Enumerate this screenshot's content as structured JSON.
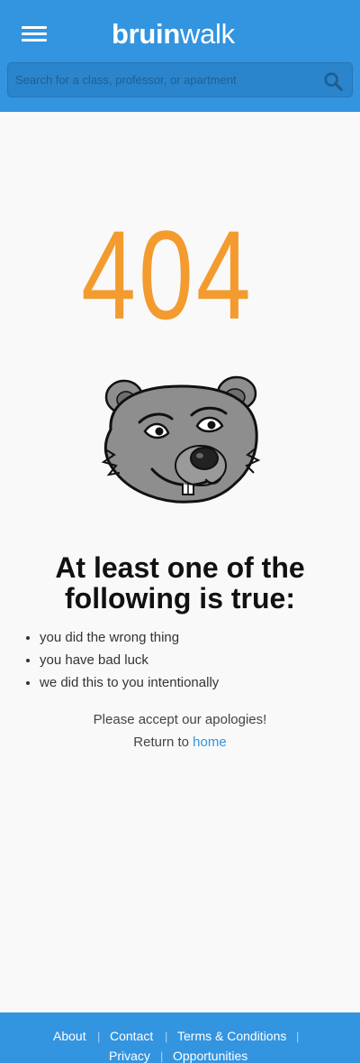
{
  "header": {
    "logo_bold": "bruin",
    "logo_light": "walk",
    "search": {
      "placeholder": "Search for a class, professor, or apartment"
    }
  },
  "error": {
    "code": "404",
    "heading": "At least one of the following is true:",
    "reasons": [
      "you did the wrong thing",
      "you have bad luck",
      "we did this to you intentionally"
    ],
    "apology": "Please accept our apologies!",
    "return_prefix": "Return to",
    "return_link": "home"
  },
  "footer": {
    "links": [
      "About",
      "Contact",
      "Terms & Conditions",
      "Privacy",
      "Opportunities"
    ],
    "separator": "|"
  },
  "colors": {
    "brand_blue": "#3394e0",
    "accent_orange": "#f39b2e"
  },
  "icons": [
    "menu-icon",
    "search-icon",
    "bear-mascot"
  ]
}
